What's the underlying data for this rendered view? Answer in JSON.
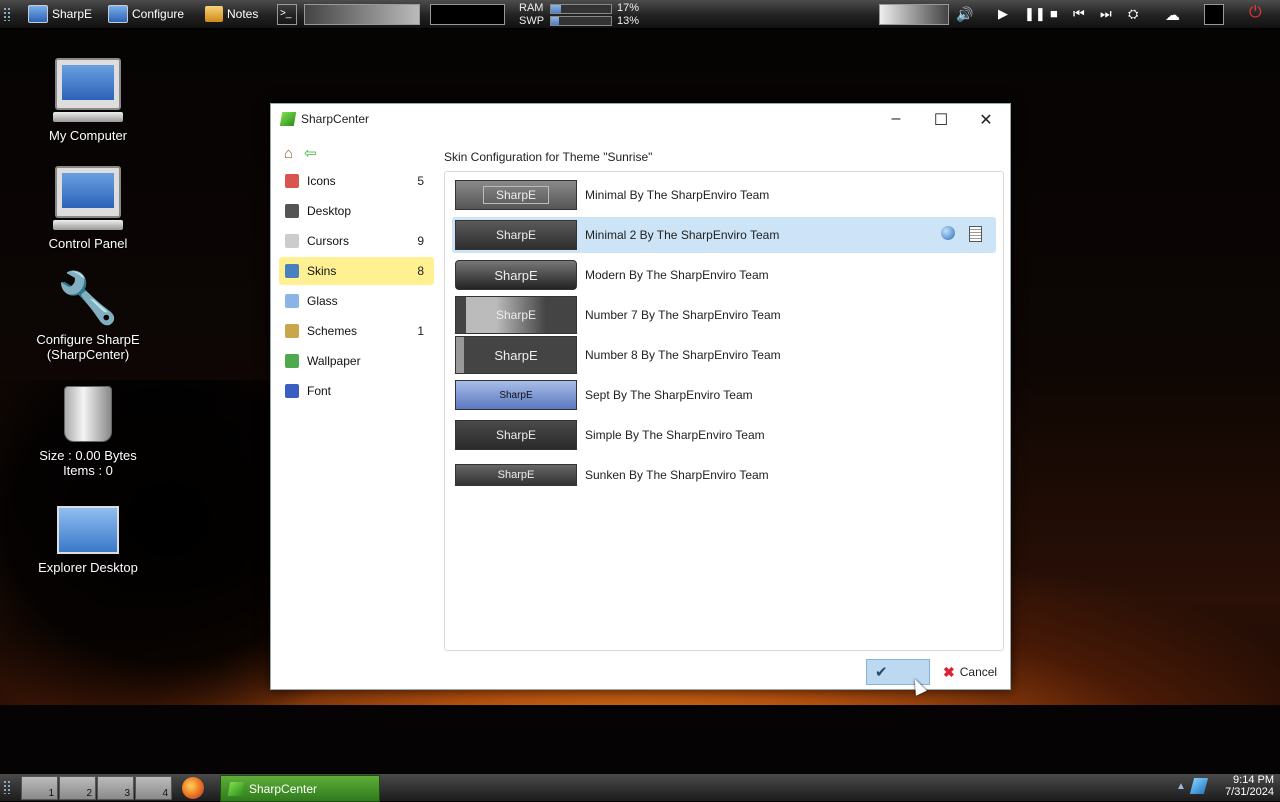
{
  "topbar": {
    "items": [
      {
        "label": "SharpE"
      },
      {
        "label": "Configure"
      },
      {
        "label": "Notes"
      }
    ],
    "ram_label": "RAM",
    "swp_label": "SWP",
    "ram_value": "17%",
    "swp_value": "13%",
    "ram_fraction": 0.17,
    "swp_fraction": 0.13
  },
  "desktop_icons": [
    {
      "label": "My Computer"
    },
    {
      "label": "Control Panel"
    },
    {
      "label": "Configure SharpE\n(SharpCenter)"
    },
    {
      "label": "Size : 0.00 Bytes\nItems : 0"
    },
    {
      "label": "Explorer Desktop"
    }
  ],
  "window": {
    "title": "SharpCenter",
    "content_title": "Skin Configuration for Theme \"Sunrise\"",
    "sidebar": [
      {
        "label": "Icons",
        "count": "5",
        "icon_color": "#d9534f"
      },
      {
        "label": "Desktop",
        "count": "",
        "icon_color": "#555555"
      },
      {
        "label": "Cursors",
        "count": "9",
        "icon_color": "#cccccc"
      },
      {
        "label": "Skins",
        "count": "8",
        "icon_color": "#4a7fc0"
      },
      {
        "label": "Glass",
        "count": "",
        "icon_color": "#8ab4e8"
      },
      {
        "label": "Schemes",
        "count": "1",
        "icon_color": "#c9a64a"
      },
      {
        "label": "Wallpaper",
        "count": "",
        "icon_color": "#4ea84e"
      },
      {
        "label": "Font",
        "count": "",
        "icon_color": "#3a5fc0"
      }
    ],
    "skins": [
      {
        "preview_text": "SharpE",
        "label": "Minimal By The SharpEnviro Team"
      },
      {
        "preview_text": "SharpE",
        "label": "Minimal 2 By The SharpEnviro Team"
      },
      {
        "preview_text": "SharpE",
        "label": "Modern By The SharpEnviro Team"
      },
      {
        "preview_text": "SharpE",
        "label": "Number 7 By The SharpEnviro Team"
      },
      {
        "preview_text": "SharpE",
        "label": "Number 8 By The SharpEnviro Team"
      },
      {
        "preview_text": "SharpE",
        "label": "Sept By The SharpEnviro Team"
      },
      {
        "preview_text": "SharpE",
        "label": "Simple By The SharpEnviro Team"
      },
      {
        "preview_text": "SharpE",
        "label": "Sunken By The SharpEnviro Team"
      }
    ],
    "selected_skin": "Minimal 2 By The SharpEnviro Team",
    "cancel_label": "Cancel"
  },
  "bottombar": {
    "pagers": [
      "1",
      "2",
      "3",
      "4"
    ],
    "task_label": "SharpCenter",
    "time": "9:14 PM",
    "date": "7/31/2024"
  },
  "colors": {
    "accent_selection": "#cde4f7",
    "sidebar_active": "#fff191",
    "task_green": "#3f8f28"
  }
}
